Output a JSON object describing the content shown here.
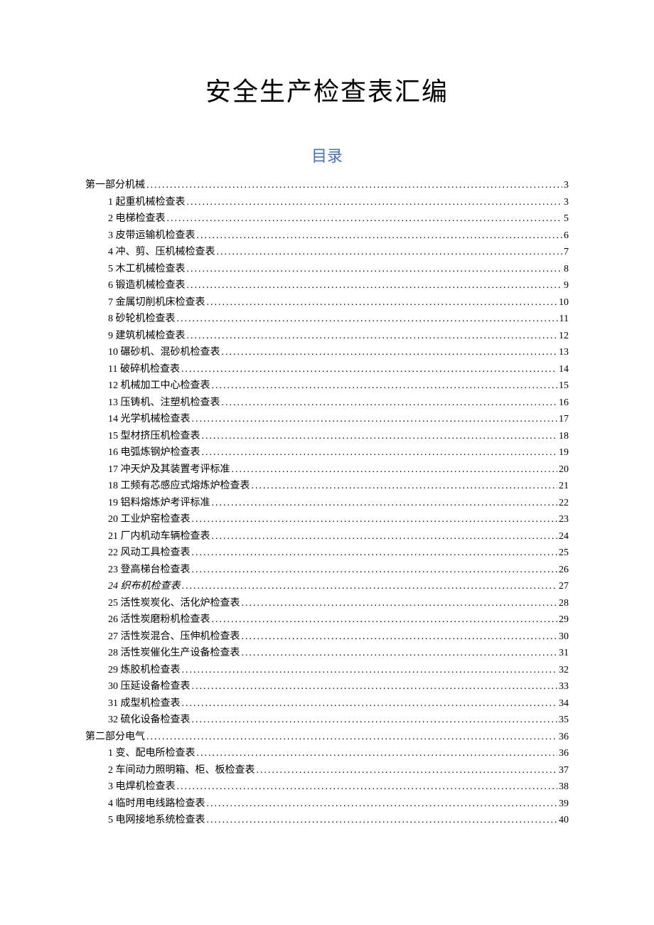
{
  "title": "安全生产检查表汇编",
  "toc_heading": "目录",
  "toc": [
    {
      "level": 0,
      "label": "第一部分机械",
      "page": "3"
    },
    {
      "level": 1,
      "label": "1 起重机械检查表",
      "page": "3"
    },
    {
      "level": 1,
      "label": "2 电梯检查表",
      "page": "5"
    },
    {
      "level": 1,
      "label": "3 皮带运输机检查表",
      "page": "6"
    },
    {
      "level": 1,
      "label": "4 冲、剪、压机械检查表",
      "page": "7"
    },
    {
      "level": 1,
      "label": "5 木工机械检查表",
      "page": "8"
    },
    {
      "level": 1,
      "label": "6 锻造机械检查表",
      "page": "9"
    },
    {
      "level": 1,
      "label": "7 金属切削机床检查表",
      "page": "10"
    },
    {
      "level": 1,
      "label": "8 砂轮机检查表",
      "page": "11"
    },
    {
      "level": 1,
      "label": "9 建筑机械检查表",
      "page": "12"
    },
    {
      "level": 1,
      "label": "10 碾砂机、混砂机检查表",
      "page": "13"
    },
    {
      "level": 1,
      "label": "11 破碎机检查表",
      "page": "14"
    },
    {
      "level": 1,
      "label": "12 机械加工中心检查表",
      "page": "15"
    },
    {
      "level": 1,
      "label": "13 压铸机、注塑机检查表",
      "page": "16"
    },
    {
      "level": 1,
      "label": "14 光学机械检查表",
      "page": "17"
    },
    {
      "level": 1,
      "label": "15 型材挤压机检查表",
      "page": "18"
    },
    {
      "level": 1,
      "label": "16 电弧炼钢炉检查表",
      "page": "19"
    },
    {
      "level": 1,
      "label": "17 冲天炉及其装置考评标准",
      "page": "20"
    },
    {
      "level": 1,
      "label": "18 工频有芯感应式熔炼炉检查表",
      "page": "21"
    },
    {
      "level": 1,
      "label": "19 铝料熔炼炉考评标准",
      "page": "22"
    },
    {
      "level": 1,
      "label": "20 工业炉窑检查表",
      "page": "23"
    },
    {
      "level": 1,
      "label": "21 厂内机动车辆检查表",
      "page": "24"
    },
    {
      "level": 1,
      "label": "22 风动工具检查表",
      "page": "25"
    },
    {
      "level": 1,
      "label": "23 登高梯台检查表",
      "page": "26"
    },
    {
      "level": 1,
      "label": "24 织布机检查表",
      "page": "27",
      "italic": true
    },
    {
      "level": 1,
      "label": "25 活性炭炭化、活化炉检查表",
      "page": "28"
    },
    {
      "level": 1,
      "label": "26 活性炭磨粉机检查表",
      "page": "29"
    },
    {
      "level": 1,
      "label": "27 活性炭混合、压伸机检查表",
      "page": "30"
    },
    {
      "level": 1,
      "label": "28 活性炭催化生产设备检查表",
      "page": "31"
    },
    {
      "level": 1,
      "label": "29 炼胶机检查表",
      "page": "32"
    },
    {
      "level": 1,
      "label": "30 压延设备检查表",
      "page": "33"
    },
    {
      "level": 1,
      "label": "31 成型机检查表",
      "page": "34"
    },
    {
      "level": 1,
      "label": "32 硫化设备检查表",
      "page": "35"
    },
    {
      "level": 0,
      "label": "第二部分电气",
      "page": "36"
    },
    {
      "level": 1,
      "label": "1 变、配电所检查表",
      "page": "36"
    },
    {
      "level": 1,
      "label": "2 车间动力照明箱、柜、板检查表",
      "page": "37"
    },
    {
      "level": 1,
      "label": "3 电焊机检查表",
      "page": "38"
    },
    {
      "level": 1,
      "label": "4 临时用电线路检查表",
      "page": "39"
    },
    {
      "level": 1,
      "label": "5 电网接地系统检查表",
      "page": "40"
    }
  ]
}
